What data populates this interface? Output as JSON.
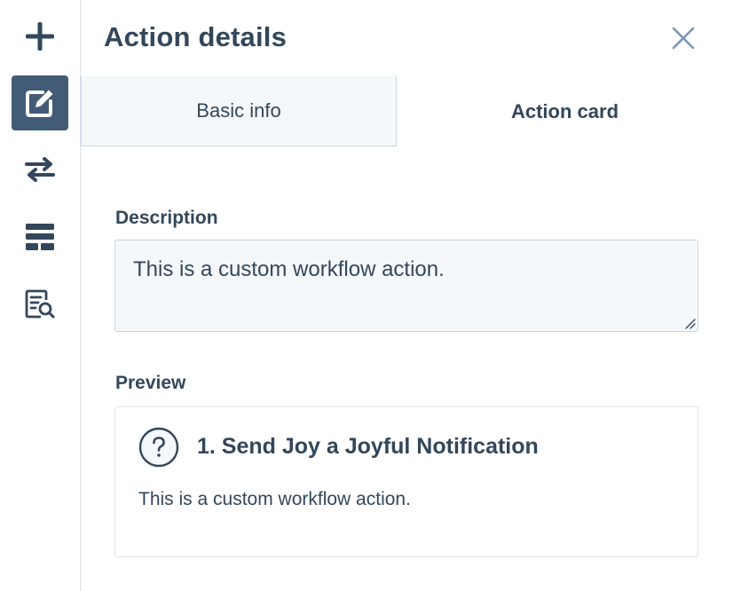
{
  "rail": {
    "items": [
      {
        "icon": "plus-icon",
        "active": false
      },
      {
        "icon": "edit-icon",
        "active": true
      },
      {
        "icon": "swap-arrows-icon",
        "active": false
      },
      {
        "icon": "layout-icon",
        "active": false
      },
      {
        "icon": "document-search-icon",
        "active": false
      }
    ]
  },
  "panel": {
    "title": "Action details",
    "close_icon": "close-icon"
  },
  "tabs": [
    {
      "label": "Basic info",
      "selected": false
    },
    {
      "label": "Action card",
      "selected": true
    }
  ],
  "description": {
    "label": "Description",
    "value": "This is a custom workflow action."
  },
  "preview": {
    "label": "Preview",
    "icon": "question-circle-icon",
    "title": "1. Send Joy a Joyful Notification",
    "text": "This is a custom workflow action."
  },
  "colors": {
    "text": "#33475b",
    "active_rail": "#425b76",
    "border": "#cbd6e2",
    "input_bg": "#f5f8fa",
    "close_icon": "#7c98b6"
  }
}
